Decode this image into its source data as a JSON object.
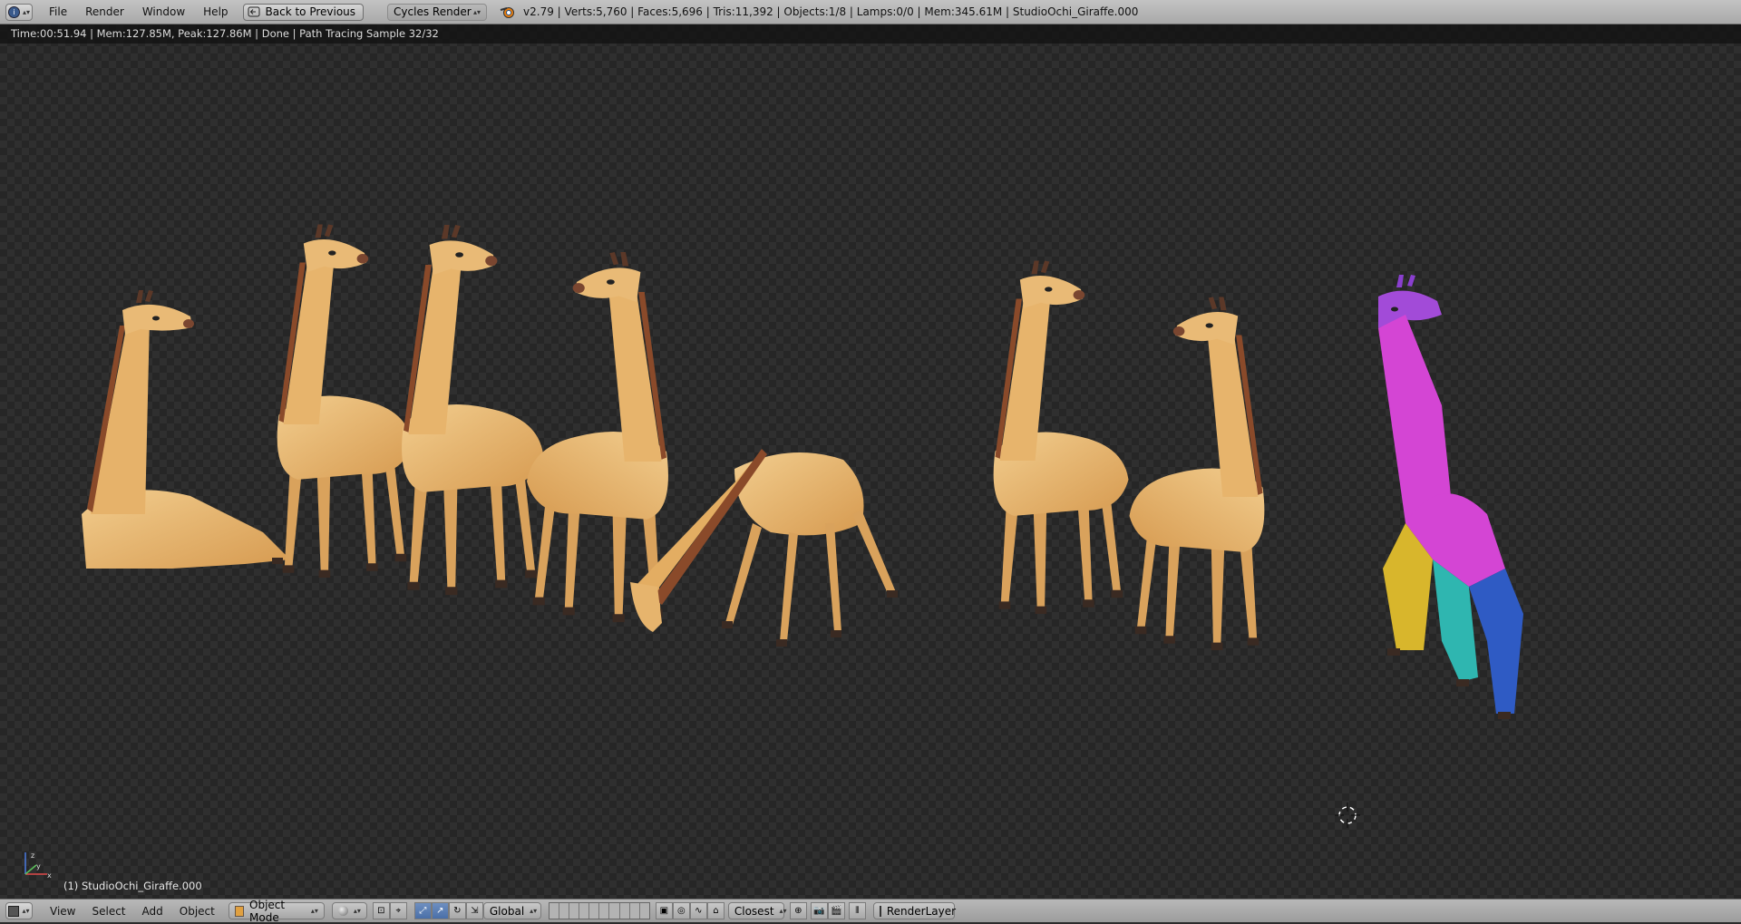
{
  "top_header": {
    "menus": [
      "File",
      "Render",
      "Window",
      "Help"
    ],
    "back_button": "Back to Previous",
    "render_engine": "Cycles Render",
    "stats": "v2.79 | Verts:5,760 | Faces:5,696 | Tris:11,392 | Objects:1/8 | Lamps:0/0 | Mem:345.61M | StudioOchi_Giraffe.000"
  },
  "viewport": {
    "render_status": "Time:00:51.94 | Mem:127.85M, Peak:127.86M | Done | Path Tracing Sample 32/32",
    "object_label": "(1) StudioOchi_Giraffe.000",
    "colors": {
      "giraffe_body": "#e8b56e",
      "giraffe_shadow": "#c98c45",
      "mane": "#8a4a2a",
      "uv_purple": "#a24bd8",
      "uv_magenta": "#d445d4",
      "uv_yellow": "#d8b62c",
      "uv_teal": "#2fb6b0",
      "uv_blue": "#2f5bc4"
    }
  },
  "bottom_header": {
    "menus": [
      "View",
      "Select",
      "Add",
      "Object"
    ],
    "mode": "Object Mode",
    "orientation": "Global",
    "snap_target": "Closest",
    "render_layer": "RenderLayer"
  }
}
